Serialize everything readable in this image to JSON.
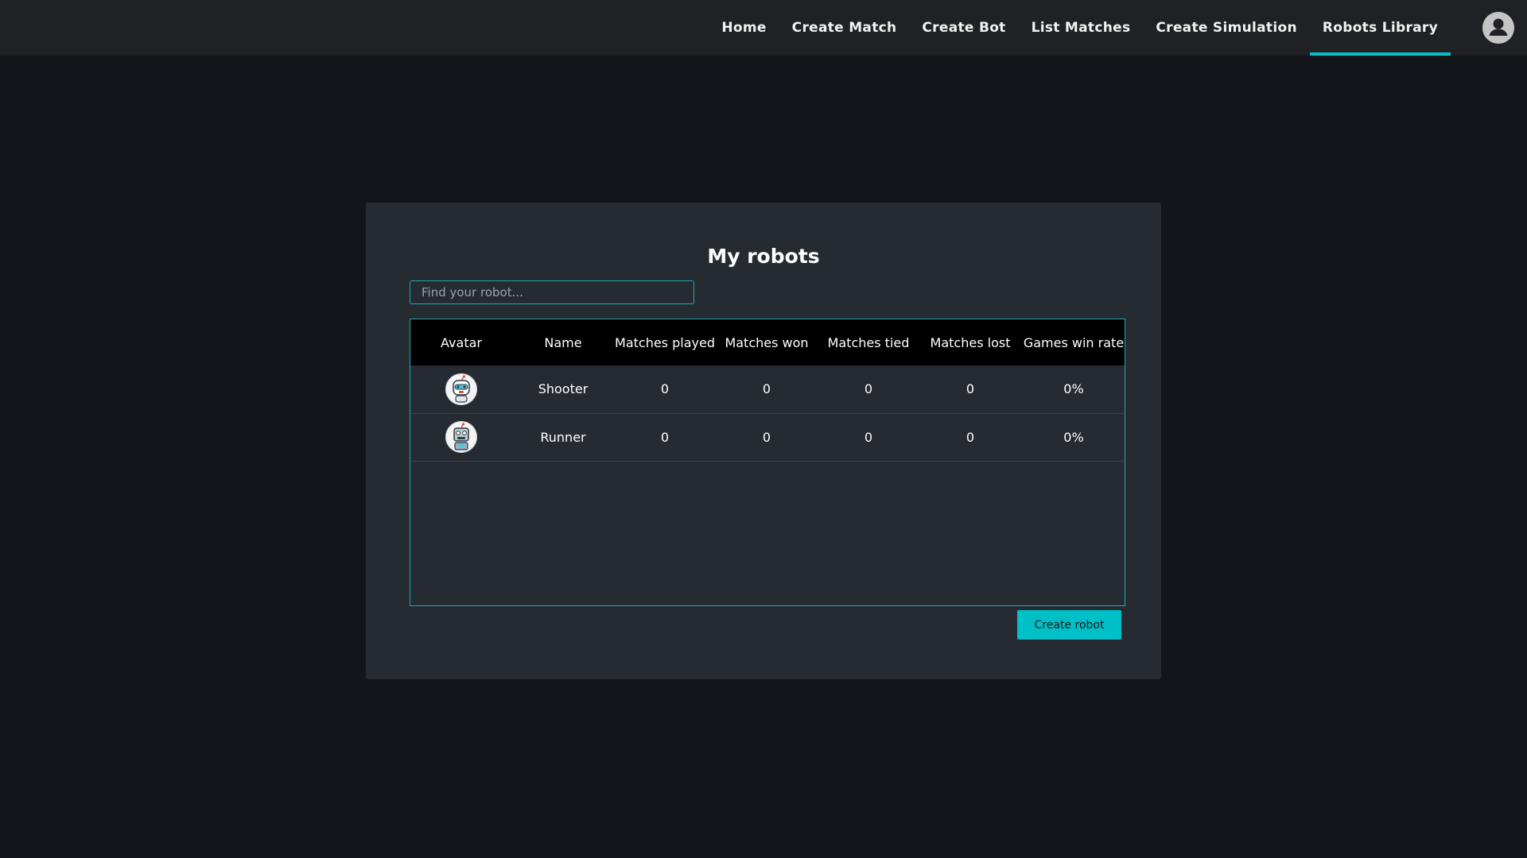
{
  "nav": {
    "items": [
      {
        "label": "Home"
      },
      {
        "label": "Create Match"
      },
      {
        "label": "Create Bot"
      },
      {
        "label": "List Matches"
      },
      {
        "label": "Create Simulation"
      },
      {
        "label": "Robots Library"
      }
    ],
    "active": "Robots Library",
    "profile_icon": "user-profile-icon"
  },
  "colors": {
    "accent": "#00c0c7",
    "background": "#12161b",
    "card": "#262b32",
    "topbar": "#202124"
  },
  "page": {
    "title": "My robots",
    "search_placeholder": "Find your robot...",
    "create_button": "Create robot"
  },
  "table": {
    "headers": [
      "Avatar",
      "Name",
      "Matches played",
      "Matches won",
      "Matches tied",
      "Matches lost",
      "Games win rate"
    ],
    "rows": [
      {
        "avatar_icon": "robot-avatar-icon",
        "name": "Shooter",
        "played": "0",
        "won": "0",
        "tied": "0",
        "lost": "0",
        "win_rate": "0%"
      },
      {
        "avatar_icon": "robot-avatar-icon",
        "name": "Runner",
        "played": "0",
        "won": "0",
        "tied": "0",
        "lost": "0",
        "win_rate": "0%"
      }
    ]
  }
}
